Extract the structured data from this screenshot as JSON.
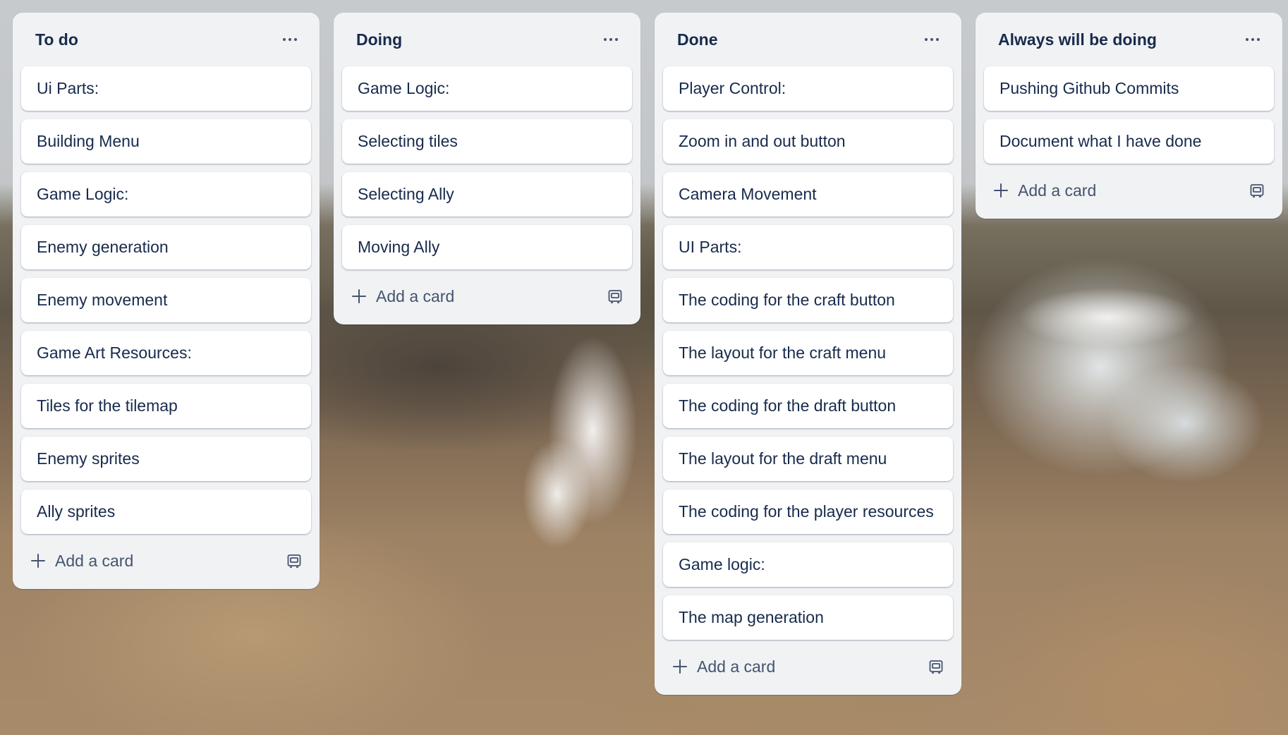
{
  "board": {
    "lists": [
      {
        "title": "To do",
        "cards": [
          "Ui Parts:",
          "Building Menu",
          "Game Logic:",
          "Enemy generation",
          "Enemy movement",
          "Game Art Resources:",
          "Tiles for the tilemap",
          "Enemy sprites",
          "Ally sprites"
        ],
        "add_label": "Add a card"
      },
      {
        "title": "Doing",
        "cards": [
          "Game Logic:",
          "Selecting tiles",
          "Selecting Ally",
          "Moving Ally"
        ],
        "add_label": "Add a card"
      },
      {
        "title": "Done",
        "cards": [
          "Player Control:",
          "Zoom in and out button",
          "Camera Movement",
          "UI Parts:",
          "The coding for the craft button",
          "The layout for the craft menu",
          "The coding for the draft button",
          "The layout for the draft menu",
          "The coding for the player resources",
          "Game logic:",
          "The map generation"
        ],
        "add_label": "Add a card"
      },
      {
        "title": "Always will be doing",
        "cards": [
          "Pushing Github Commits",
          "Document what I have done"
        ],
        "add_label": "Add a card"
      }
    ]
  },
  "icons": {
    "list_menu": "ellipsis-icon",
    "add": "plus-icon",
    "template": "card-template-icon"
  },
  "colors": {
    "list_background": "#f1f2f4",
    "card_background": "#ffffff",
    "text_primary": "#172b4d",
    "text_secondary": "#44546f"
  }
}
